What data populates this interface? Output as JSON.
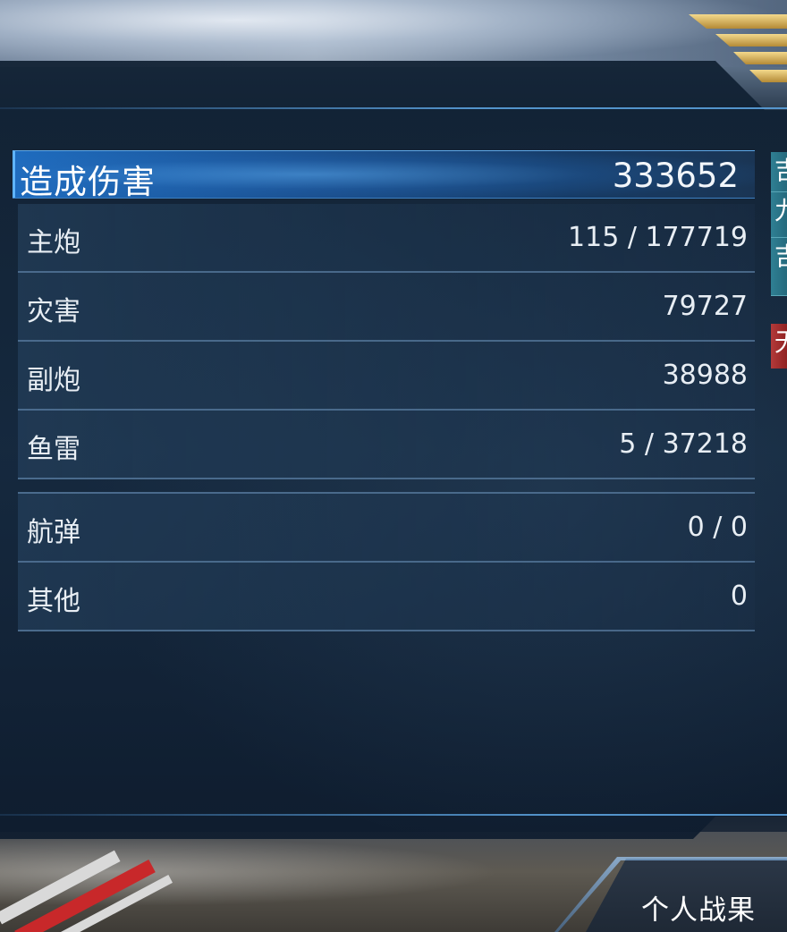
{
  "colors": {
    "header_bar": "#1e6cbf",
    "panel_bg": "#14283e",
    "row_divider": "#6e96be",
    "side_tab_teal": "#2f7f93",
    "side_tab_red": "#b33a3a",
    "rank_gold": "#d9b35a"
  },
  "icons": {
    "rank": "gold-chevron-rank-icon"
  },
  "damage": {
    "label": "造成伤害",
    "total": "333652",
    "rows": [
      {
        "label": "主炮",
        "value": "115 / 177719"
      },
      {
        "label": "灾害",
        "value": "79727"
      },
      {
        "label": "副炮",
        "value": "38988"
      },
      {
        "label": "鱼雷",
        "value": "5 / 37218"
      },
      {
        "label": "航弹",
        "value": "0 / 0"
      },
      {
        "label": "其他",
        "value": "0"
      }
    ]
  },
  "side_tabs": [
    {
      "label": "吉",
      "tone": "teal"
    },
    {
      "label": "九",
      "tone": "teal"
    },
    {
      "label": "吉",
      "tone": "teal"
    },
    {
      "label": "无",
      "tone": "red"
    }
  ],
  "bottom_button": {
    "label": "个人战果"
  }
}
